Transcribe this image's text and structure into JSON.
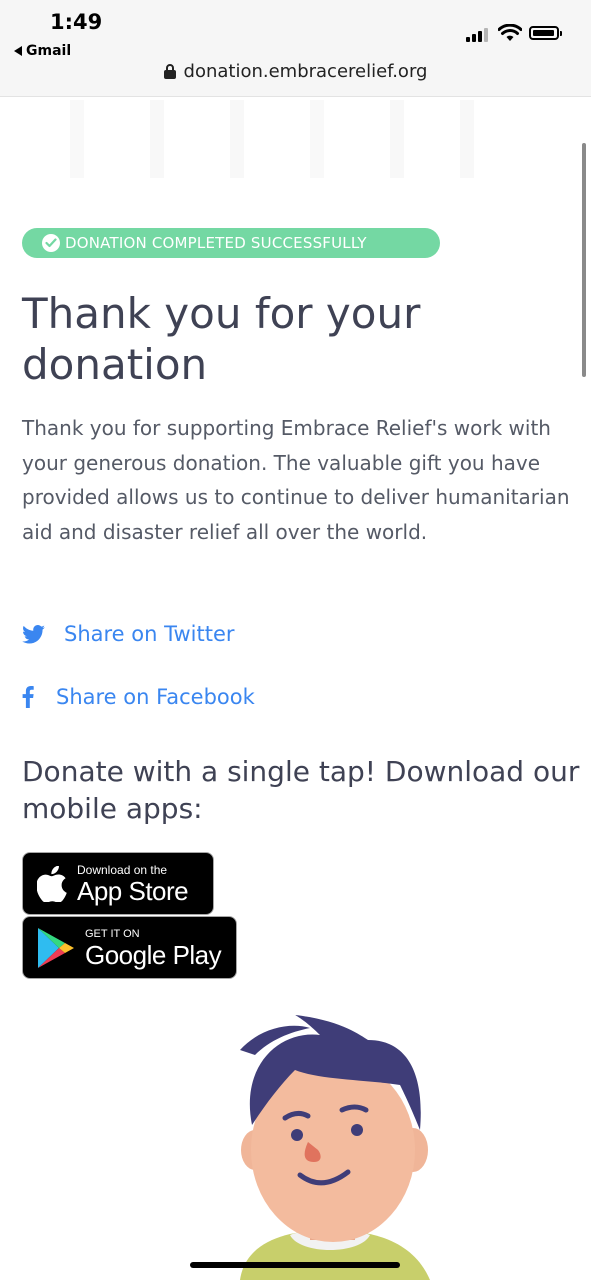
{
  "status_bar": {
    "time": "1:49",
    "back_app": "Gmail"
  },
  "browser": {
    "url": "donation.embracerelief.org"
  },
  "badge": {
    "text": "DONATION COMPLETED SUCCESSFULLY",
    "color": "#74d8a3"
  },
  "main": {
    "title": "Thank you for your donation",
    "body": "Thank you for supporting Embrace Relief's work with your generous donation. The valuable gift you have provided allows us to continue to deliver humanitarian aid and disaster relief all over the world.",
    "share_twitter": "Share on Twitter",
    "share_facebook": "Share on Facebook",
    "apps_heading": "Donate with a single tap! Download our mobile apps:"
  },
  "stores": {
    "apple_small": "Download on the",
    "apple_big": "App Store",
    "google_small": "GET IT ON",
    "google_big": "Google Play"
  },
  "colors": {
    "link": "#3a86f0",
    "heading": "#3f4254",
    "text": "#555a66"
  }
}
